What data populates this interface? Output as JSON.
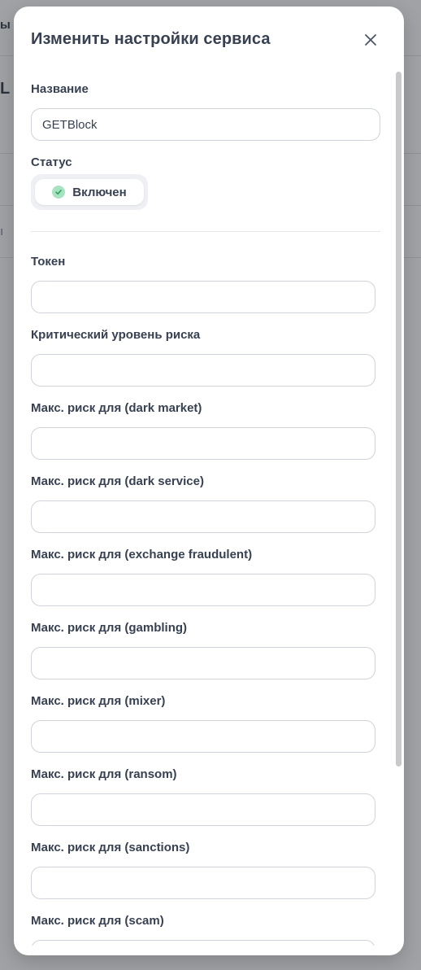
{
  "background": {
    "fragment_1": "ы",
    "fragment_2": "L ",
    "fragment_3": "ı"
  },
  "modal": {
    "title": "Изменить настройки сервиса",
    "close_label": "×"
  },
  "form": {
    "name": {
      "label": "Название",
      "value": "GETBlock"
    },
    "status": {
      "label": "Статус",
      "value": "Включен"
    },
    "token": {
      "label": "Токен",
      "value": ""
    },
    "critical_risk": {
      "label": "Критический уровень риска",
      "value": ""
    },
    "risk_fields": [
      {
        "label": "Макс. риск для (dark market)",
        "value": ""
      },
      {
        "label": "Макс. риск для (dark service)",
        "value": ""
      },
      {
        "label": "Макс. риск для (exchange fraudulent)",
        "value": ""
      },
      {
        "label": "Макс. риск для (gambling)",
        "value": ""
      },
      {
        "label": "Макс. риск для (mixer)",
        "value": ""
      },
      {
        "label": "Макс. риск для (ransom)",
        "value": ""
      },
      {
        "label": "Макс. риск для (sanctions)",
        "value": ""
      },
      {
        "label": "Макс. риск для (scam)",
        "value": ""
      }
    ]
  },
  "colors": {
    "text": "#374151",
    "border": "#cfd3da",
    "status_check": "#a7e3c0",
    "check_mark": "#2f9e5e"
  },
  "icons": {
    "close": "close-icon",
    "status": "check-circle-icon"
  }
}
